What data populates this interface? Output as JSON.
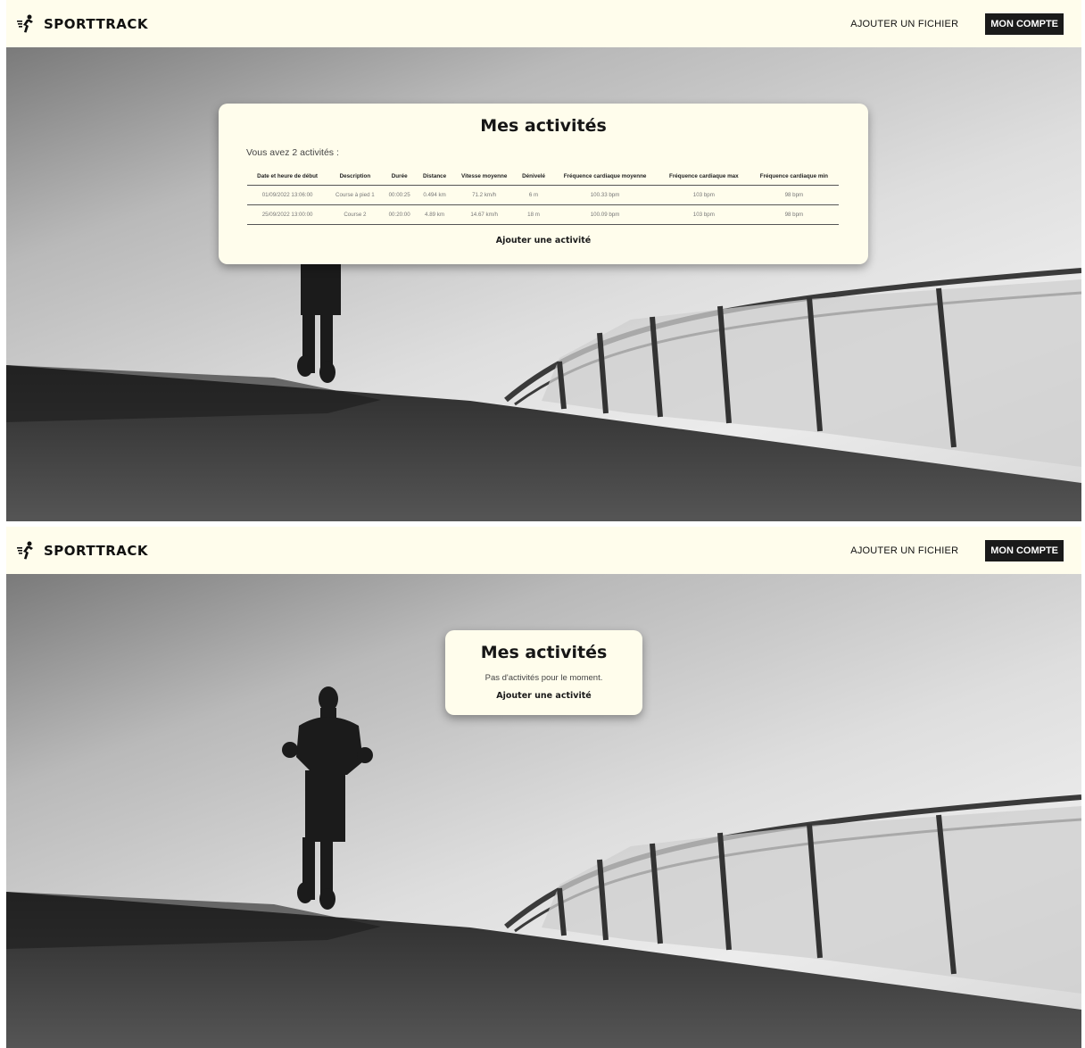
{
  "navbar": {
    "brand": "SPORTTRACK",
    "add_file": "AJOUTER UN FICHIER",
    "account": "MON COMPTE"
  },
  "view_with_activities": {
    "title": "Mes activités",
    "count_text": "Vous avez 2 activités :",
    "columns": [
      "Date et heure de début",
      "Description",
      "Durée",
      "Distance",
      "Vitesse moyenne",
      "Dénivelé",
      "Fréquence cardiaque moyenne",
      "Fréquence cardiaque max",
      "Fréquence cardiaque min"
    ],
    "rows": [
      [
        "01/09/2022 13:06:00",
        "Course à pied 1",
        "00:00:25",
        "0.494 km",
        "71.2 km/h",
        "6 m",
        "100.33 bpm",
        "103 bpm",
        "98 bpm"
      ],
      [
        "25/09/2022 13:00:00",
        "Course 2",
        "00:20:00",
        "4.89 km",
        "14.67 km/h",
        "18 m",
        "100.09 bpm",
        "103 bpm",
        "98 bpm"
      ]
    ],
    "add_activity": "Ajouter une activité"
  },
  "view_empty": {
    "title": "Mes activités",
    "empty_text": "Pas d'activités pour le moment.",
    "add_activity": "Ajouter une activité"
  },
  "colors": {
    "navbar_bg": "#fffdec",
    "card_bg": "#fffdec",
    "button_bg": "#1a1a1a"
  }
}
